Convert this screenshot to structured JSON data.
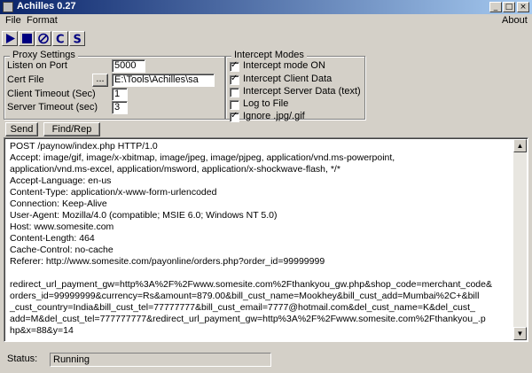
{
  "window": {
    "title": "Achilles 0.27",
    "min_glyph": "_",
    "max_glyph": "□",
    "close_glyph": "×"
  },
  "menu": {
    "file": "File",
    "format": "Format",
    "about": "About"
  },
  "toolbar": {
    "icons": [
      "play-icon",
      "stop-icon",
      "no-icon",
      "c-icon",
      "s-icon"
    ],
    "c_glyph": "C",
    "s_glyph": "S"
  },
  "proxy": {
    "legend": "Proxy Settings",
    "listen_port_label": "Listen on Port",
    "listen_port_value": "5000",
    "cert_file_label": "Cert File",
    "cert_browse_label": "...",
    "cert_file_value": "E:\\Tools\\Achilles\\sa",
    "client_timeout_label": "Client Timeout (Sec)",
    "client_timeout_value": "1",
    "server_timeout_label": "Server Timeout (sec)",
    "server_timeout_value": "3"
  },
  "intercept": {
    "legend": "Intercept Modes",
    "options": [
      {
        "label": "Intercept mode ON",
        "checked": true
      },
      {
        "label": "Intercept Client Data",
        "checked": true
      },
      {
        "label": "Intercept Server Data (text)",
        "checked": false
      },
      {
        "label": "Log to File",
        "checked": false
      },
      {
        "label": "Ignore .jpg/.gif",
        "checked": true
      }
    ]
  },
  "actions": {
    "send": "Send",
    "find_rep": "Find/Rep"
  },
  "request_text": "POST /paynow/index.php HTTP/1.0\nAccept: image/gif, image/x-xbitmap, image/jpeg, image/pjpeg, application/vnd.ms-powerpoint,\napplication/vnd.ms-excel, application/msword, application/x-shockwave-flash, */*\nAccept-Language: en-us\nContent-Type: application/x-www-form-urlencoded\nConnection: Keep-Alive\nUser-Agent: Mozilla/4.0 (compatible; MSIE 6.0; Windows NT 5.0)\nHost: www.somesite.com\nContent-Length: 464\nCache-Control: no-cache\nReferer: http://www.somesite.com/payonline/orders.php?order_id=99999999\n\nredirect_url_payment_gw=http%3A%2F%2Fwww.somesite.com%2Fthankyou_gw.php&shop_code=merchant_code&\norders_id=99999999&currency=Rs&amount=879.00&bill_cust_name=Mookhey&bill_cust_add=Mumbai%2C+&bill\n_cust_country=India&bill_cust_tel=77777777&bill_cust_email=7777@hotmail.com&del_cust_name=K&del_cust_\nadd=M&del_cust_tel=777777777&redirect_url_payment_gw=http%3A%2F%2Fwww.somesite.com%2Fthankyou_.p\nhp&x=88&y=14",
  "scroll": {
    "up_glyph": "▲",
    "down_glyph": "▼"
  },
  "status": {
    "label": "Status:",
    "value": "Running"
  }
}
